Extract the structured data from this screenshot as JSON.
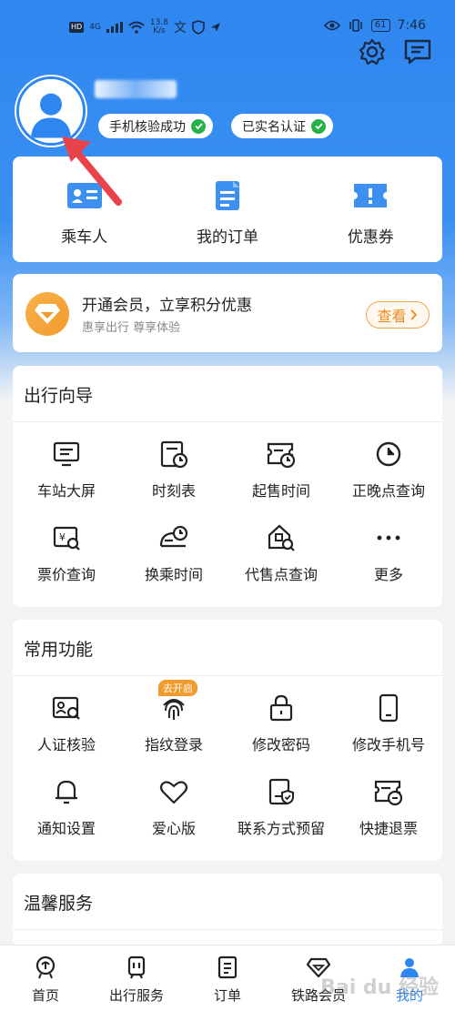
{
  "status_bar": {
    "network_badge": "HD",
    "signal_label": "4G",
    "speed_value": "13.8",
    "speed_unit": "K/s",
    "battery": "61",
    "time": "7:46"
  },
  "header": {
    "settings_icon": "gear-icon",
    "message_icon": "message-icon",
    "badges": [
      {
        "label": "手机核验成功"
      },
      {
        "label": "已实名认证"
      }
    ]
  },
  "quick_actions": [
    {
      "label": "乘车人",
      "icon": "passenger-card-icon"
    },
    {
      "label": "我的订单",
      "icon": "order-doc-icon"
    },
    {
      "label": "优惠券",
      "icon": "coupon-icon"
    }
  ],
  "vip": {
    "title": "开通会员，立享积分优惠",
    "subtitle": "惠享出行 尊享体验",
    "button": "查看"
  },
  "guide": {
    "title": "出行向导",
    "items": [
      {
        "label": "车站大屏",
        "icon": "screen-icon"
      },
      {
        "label": "时刻表",
        "icon": "timetable-icon"
      },
      {
        "label": "起售时间",
        "icon": "sale-time-icon"
      },
      {
        "label": "正晚点查询",
        "icon": "clock-icon"
      },
      {
        "label": "票价查询",
        "icon": "fare-search-icon"
      },
      {
        "label": "换乘时间",
        "icon": "transfer-icon"
      },
      {
        "label": "代售点查询",
        "icon": "agency-search-icon"
      },
      {
        "label": "更多",
        "icon": "more-icon"
      }
    ]
  },
  "common": {
    "title": "常用功能",
    "tag": "去开启",
    "items": [
      {
        "label": "人证核验",
        "icon": "id-verify-icon"
      },
      {
        "label": "指纹登录",
        "icon": "fingerprint-icon"
      },
      {
        "label": "修改密码",
        "icon": "lock-icon"
      },
      {
        "label": "修改手机号",
        "icon": "phone-icon"
      },
      {
        "label": "通知设置",
        "icon": "bell-icon"
      },
      {
        "label": "爱心版",
        "icon": "heart-icon"
      },
      {
        "label": "联系方式预留",
        "icon": "contact-shield-icon"
      },
      {
        "label": "快捷退票",
        "icon": "refund-ticket-icon"
      }
    ]
  },
  "warm": {
    "title": "温馨服务"
  },
  "tabs": [
    {
      "label": "首页",
      "icon": "home-rail-icon"
    },
    {
      "label": "出行服务",
      "icon": "train-icon"
    },
    {
      "label": "订单",
      "icon": "order-icon"
    },
    {
      "label": "铁路会员",
      "icon": "diamond-icon"
    },
    {
      "label": "我的",
      "icon": "user-icon"
    }
  ],
  "watermark": "Bai du 经验",
  "colors": {
    "primary": "#2e86f0",
    "orange": "#f39a2c",
    "check": "#27b14a",
    "arrow": "#e8434a"
  }
}
